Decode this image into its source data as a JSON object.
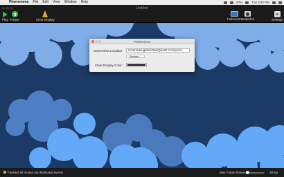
{
  "menubar": {
    "apple": "",
    "items": [
      "Phenomena",
      "File",
      "Edit",
      "View",
      "Window",
      "Help"
    ],
    "status": {
      "battery": "97%",
      "time": "Tue 3:42 PM"
    }
  },
  "window": {
    "title": "Untitled",
    "toolbar": {
      "play": "Play",
      "pause": "Pause",
      "clear_display": "Clear Display",
      "fullscreen": "Fullscreen",
      "snapshot": "Snapshot",
      "settings": "Settings"
    }
  },
  "preferences": {
    "title": "Preferences",
    "screenshot_location_label": "Screenshot Location:",
    "screenshot_location_value": "/Users/douglasselton/Quartz Composit",
    "browse_label": "Browse...",
    "clear_display_color_label": "Clear Display Color:",
    "clear_display_color": "#000000"
  },
  "bottombar": {
    "forward_events_label": "Forward all mouse and keyboard events",
    "forward_events_checked": true,
    "max_frame_rate_label": "Max Frame Rate:",
    "frame_rate_value": "30 fps",
    "frame_rate_fraction": 0.33
  },
  "colors": {
    "content_background": "#1b3a66",
    "cloud_light": "#86b4f0",
    "cloud_mid": "#5b8fdc",
    "cloud_bright": "#64a8f8"
  }
}
